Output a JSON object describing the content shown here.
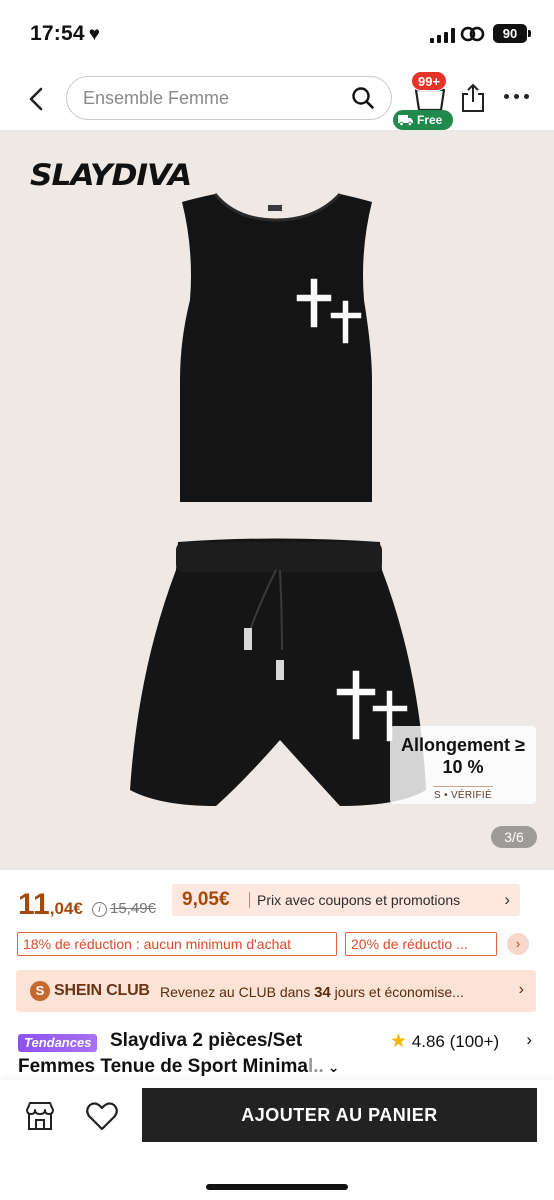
{
  "status_bar": {
    "time": "17:54",
    "battery": "90"
  },
  "header": {
    "search_placeholder": "Ensemble Femme",
    "cart_badge": "99+",
    "free_label": "Free"
  },
  "gallery": {
    "brand": "SLAYDIVA",
    "stretch_title": "Allongement ≥ 10 %",
    "stretch_subtitle": "S • VÉRIFIÉ",
    "page_indicator": "3/6"
  },
  "price": {
    "current_int": "11",
    "current_dec": ",04€",
    "original": "15,49€",
    "coupon_price": "9,05€",
    "coupon_label": "Prix avec coupons et promotions",
    "arrow": "›"
  },
  "discounts": [
    "18% de réduction : aucun minimum d'achat",
    "20% de réductio ..."
  ],
  "club": {
    "title": "SHEIN CLUB",
    "text_prefix": "Revenez au CLUB dans ",
    "days": "34",
    "text_suffix": " jours et économise..."
  },
  "product": {
    "trend_badge": "Tendances",
    "title_line1": "Slaydiva 2 pièces/Set",
    "title_line2": "Femmes Tenue de Sport Minima",
    "title_fade": "l..",
    "rating": "4.86",
    "reviews": "(100+)"
  },
  "bottom_bar": {
    "add_to_cart": "AJOUTER AU PANIER"
  },
  "colors": {
    "price": "#a4490b",
    "accent_red": "#e8332a",
    "free_green": "#1f8a4c",
    "trend_purple": "#8c52f1",
    "button_dark": "#222222"
  },
  "icons": [
    "back-icon",
    "search-icon",
    "cart-icon",
    "truck-icon",
    "share-icon",
    "more-icon",
    "info-icon",
    "star-icon",
    "store-icon",
    "heart-icon"
  ]
}
